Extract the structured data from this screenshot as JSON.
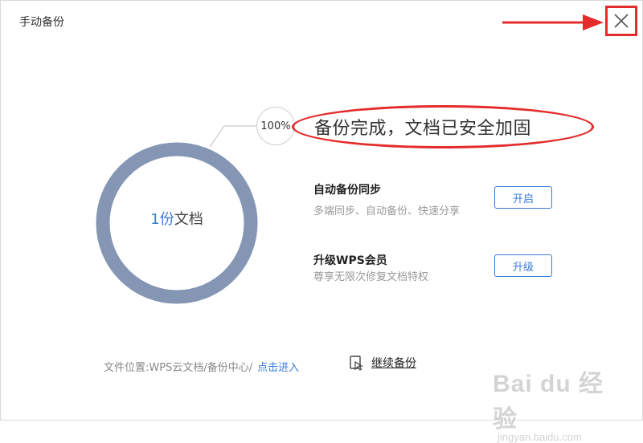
{
  "window": {
    "title": "手动备份"
  },
  "progress": {
    "percent_label": "100%",
    "value": 1.0
  },
  "status": {
    "headline": "备份完成，文档已安全加固"
  },
  "summary": {
    "count": "1份",
    "unit": "文档"
  },
  "features": [
    {
      "title": "自动备份同步",
      "desc": "多端同步、自动备份、快速分享",
      "button": "开启"
    },
    {
      "title": "升级WPS会员",
      "desc": "尊享无限次修复文档特权",
      "button": "升级"
    }
  ],
  "footer": {
    "location_text": "文件位置:WPS云文档/备份中心/",
    "link_text": "点击进入",
    "continue_label": "继续备份"
  },
  "watermark": {
    "brand": "Bai du 经验",
    "url": "jingyan.baidu.com"
  },
  "colors": {
    "accent": "#3b7ad9",
    "ring": "#8496b4",
    "annotation": "#e52b2b"
  }
}
